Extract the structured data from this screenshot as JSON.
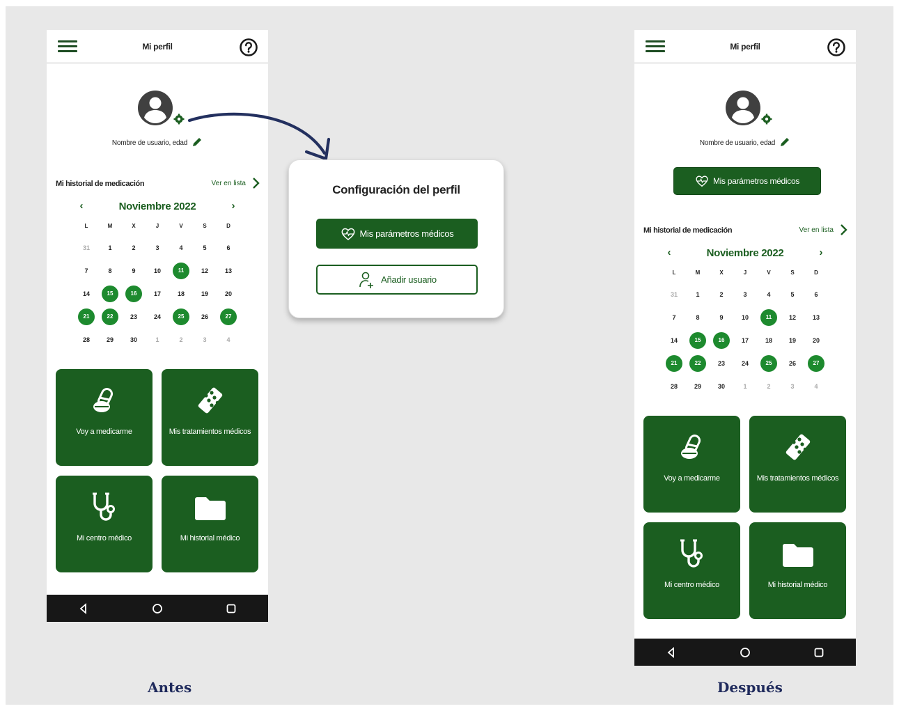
{
  "before": {
    "topbar": {
      "title": "Mi perfil",
      "menu_icon": "menu-icon",
      "help_icon": "help-icon"
    },
    "profile": {
      "user_text": "Nombre de usuario, edad",
      "avatar_icon": "user-avatar-icon",
      "gear_icon": "gear-icon",
      "edit_icon": "pencil-icon"
    },
    "history": {
      "title": "Mi historial de medicación",
      "link": "Ver en lista"
    },
    "calendar": {
      "month": "Noviembre 2022",
      "prev": "‹",
      "next": "›",
      "weekdays": [
        "L",
        "M",
        "X",
        "J",
        "V",
        "S",
        "D"
      ],
      "days": [
        "31",
        "1",
        "2",
        "3",
        "4",
        "5",
        "6",
        "7",
        "8",
        "9",
        "10",
        "11",
        "12",
        "13",
        "14",
        "15",
        "16",
        "17",
        "18",
        "19",
        "20",
        "21",
        "22",
        "23",
        "24",
        "25",
        "26",
        "27",
        "28",
        "29",
        "30",
        "1",
        "2",
        "3",
        "4"
      ],
      "highlighted": [
        "11",
        "15",
        "16",
        "21",
        "22",
        "25",
        "27"
      ]
    },
    "tiles": [
      {
        "label": "Voy a medicarme",
        "icon": "pills-icon"
      },
      {
        "label": "Mis tratamientos médicos",
        "icon": "blister-pack-icon"
      },
      {
        "label": "Mi centro médico",
        "icon": "stethoscope-icon"
      },
      {
        "label": "Mi historial médico",
        "icon": "folder-icon"
      }
    ],
    "nav": {
      "back_icon": "back-triangle-icon",
      "home_icon": "home-circle-icon",
      "recent_icon": "recent-square-icon"
    }
  },
  "config": {
    "title": "Configuración del perfil",
    "params_label": "Mis parámetros médicos",
    "params_icon": "heart-pulse-icon",
    "add_label": "Añadir usuario",
    "add_icon": "add-user-icon"
  },
  "after": {
    "topbar": {
      "title": "Mi perfil"
    },
    "profile": {
      "user_text": "Nombre de usuario, edad"
    },
    "params_button": "Mis parámetros médicos",
    "history": {
      "title": "Mi historial de medicación",
      "link": "Ver en lista"
    },
    "calendar": {
      "month": "Noviembre 2022"
    },
    "tiles": [
      {
        "label": "Voy a medicarme"
      },
      {
        "label": "Mis tratamientos médicos"
      },
      {
        "label": "Mi centro médico"
      },
      {
        "label": "Mi historial médico"
      }
    ]
  },
  "captions": {
    "before": "Antes",
    "after": "Después"
  },
  "colors": {
    "primary_green": "#1b5e20",
    "highlight_green": "#1d8a2e",
    "arrow_navy": "#23305f",
    "caption_navy": "#1f2a5c",
    "background": "#e8e8e8"
  }
}
